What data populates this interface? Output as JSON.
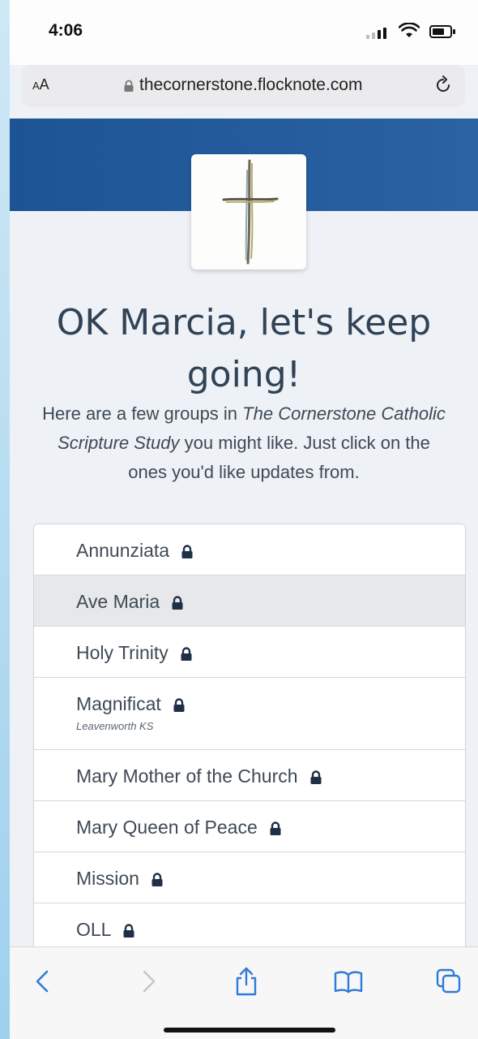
{
  "status_bar": {
    "time": "4:06"
  },
  "browser": {
    "aa_label_small": "A",
    "aa_label_large": "A",
    "url": "thecornerstone.flocknote.com",
    "icons": [
      "lock-icon",
      "reload-icon",
      "back-icon",
      "forward-icon",
      "share-icon",
      "bookmarks-icon",
      "tabs-icon"
    ]
  },
  "page": {
    "heading": "OK Marcia, let's keep going!",
    "intro_before": "Here are a few groups in ",
    "intro_org": "The Cornerstone Catholic Scripture Study",
    "intro_after": " you might like. Just click on the ones you'd like updates from."
  },
  "groups": [
    {
      "name": "Annunziata",
      "subtitle": "",
      "selected": false,
      "locked": true
    },
    {
      "name": "Ave Maria",
      "subtitle": "",
      "selected": true,
      "locked": true
    },
    {
      "name": "Holy Trinity",
      "subtitle": "",
      "selected": false,
      "locked": true
    },
    {
      "name": "Magnificat",
      "subtitle": "Leavenworth KS",
      "selected": false,
      "locked": true
    },
    {
      "name": "Mary Mother of the Church",
      "subtitle": "",
      "selected": false,
      "locked": true
    },
    {
      "name": "Mary Queen of Peace",
      "subtitle": "",
      "selected": false,
      "locked": true
    },
    {
      "name": "Mission",
      "subtitle": "",
      "selected": false,
      "locked": true
    },
    {
      "name": "OLL",
      "subtitle": "",
      "selected": false,
      "locked": true
    }
  ],
  "colors": {
    "banner": "#1d5496",
    "heading_text": "#304356",
    "lock_icon": "#1f2f45",
    "toolbar_icon": "#2f7bd8",
    "selected_row": "#e6e8ea"
  }
}
